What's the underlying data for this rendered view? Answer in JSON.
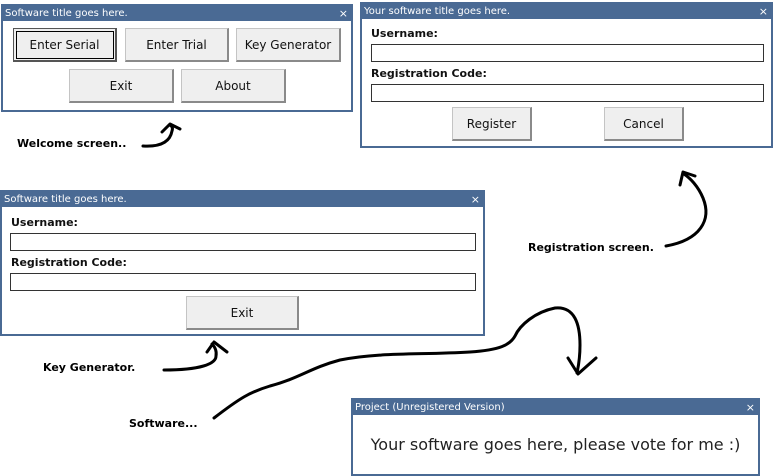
{
  "welcome": {
    "title": "Software title goes here.",
    "close": "×",
    "buttons": {
      "enter_serial": "Enter Serial",
      "enter_trial": "Enter Trial",
      "key_generator": "Key Generator",
      "exit": "Exit",
      "about": "About"
    }
  },
  "registration": {
    "title": "Your software title goes here.",
    "close": "×",
    "username_label": "Username:",
    "username_value": "",
    "code_label": "Registration Code:",
    "code_value": "",
    "register_button": "Register",
    "cancel_button": "Cancel"
  },
  "keygen": {
    "title": "Software title goes here.",
    "close": "×",
    "username_label": "Username:",
    "username_value": "",
    "code_label": "Registration Code:",
    "code_value": "",
    "exit_button": "Exit"
  },
  "app": {
    "title": "Project (Unregistered Version)",
    "close": "×",
    "message": "Your software goes here, please vote for me :)"
  },
  "annotations": {
    "welcome": "Welcome screen..",
    "registration": "Registration screen.",
    "keygen": "Key Generator.",
    "software": "Software..."
  },
  "colors": {
    "titlebar": "#4a6a94",
    "button_face": "#efefef"
  }
}
